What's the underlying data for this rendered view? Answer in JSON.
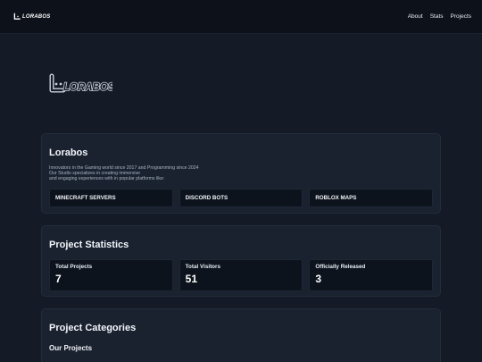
{
  "nav": {
    "brand": "LORABOS",
    "links": [
      "About",
      "Stats",
      "Projects"
    ]
  },
  "hero": {
    "logo_text": "LORABOS"
  },
  "about": {
    "title": "Lorabos",
    "desc_lines": [
      "Innovators in the Gaming world since 2017 and Programming since 2024",
      "Our Studio specializes in creating immersive",
      "and engaging experiences with in popular platforms like:"
    ],
    "platforms": [
      "MINECRAFT SERVERS",
      "DISCORD BOTS",
      "ROBLOX MAPS"
    ]
  },
  "stats": {
    "title": "Project Statistics",
    "items": [
      {
        "label": "Total Projects",
        "value": "7"
      },
      {
        "label": "Total Visitors",
        "value": "51"
      },
      {
        "label": "Officially Released",
        "value": "3"
      }
    ]
  },
  "categories": {
    "title": "Project Categories",
    "subtitle": "Our Projects"
  },
  "colors": {
    "background": "#141b26",
    "topbar": "#0d121a",
    "card": "#1a2230",
    "tile": "#0d131c"
  }
}
